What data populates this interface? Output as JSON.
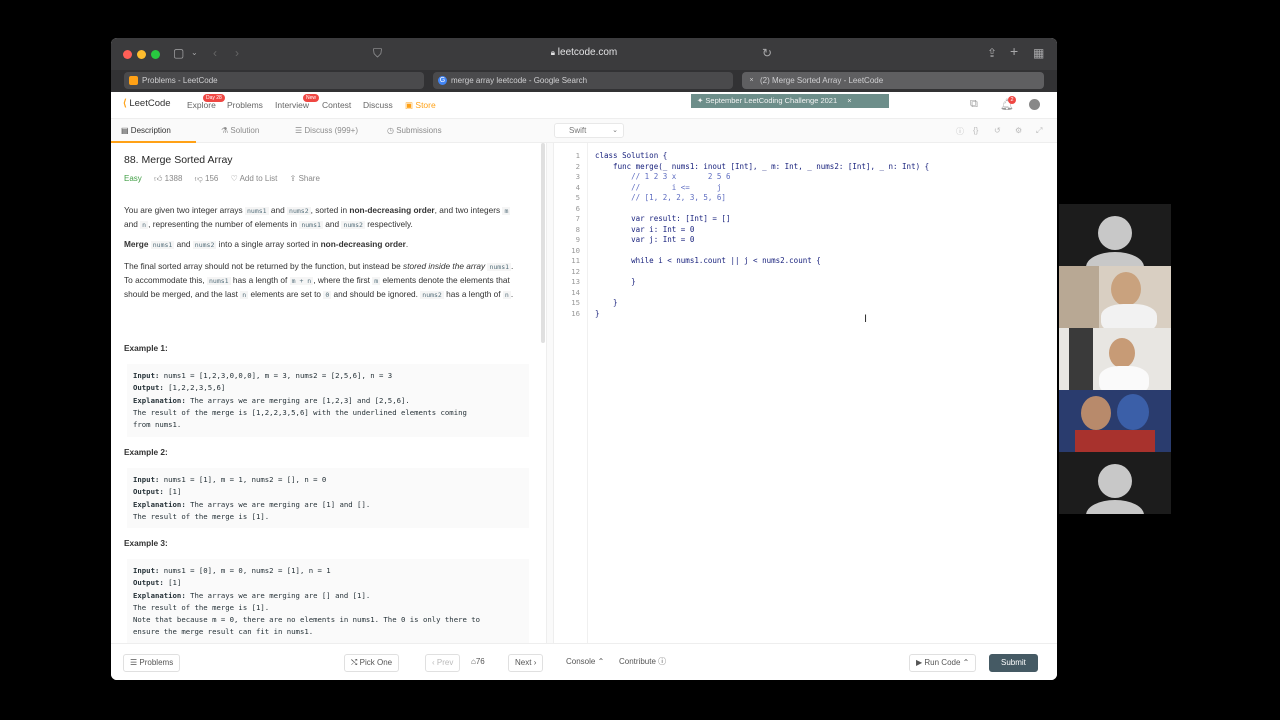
{
  "browser": {
    "url": "leetcode.com",
    "tabs": [
      {
        "title": "Problems - LeetCode"
      },
      {
        "title": "merge array leetcode - Google Search"
      },
      {
        "title": "(2) Merge Sorted Array - LeetCode"
      }
    ]
  },
  "nav": {
    "logo": "LeetCode",
    "items": [
      "Explore",
      "Problems",
      "Interview",
      "Contest",
      "Discuss",
      "Store"
    ],
    "explore_badge": "Day 28",
    "interview_badge": "New",
    "challenge": "September LeetCoding Challenge 2021",
    "notification_count": "2"
  },
  "subtabs": {
    "description": "Description",
    "solution": "Solution",
    "discuss": "Discuss (999+)",
    "submissions": "Submissions",
    "language": "Swift"
  },
  "problem": {
    "title": "88. Merge Sorted Array",
    "difficulty": "Easy",
    "likes": "1388",
    "dislikes": "156",
    "add_to_list": "Add to List",
    "share": "Share",
    "p1": {
      "a": "You are given two integer arrays ",
      "c1": "nums1",
      "b": " and ",
      "c2": "nums2",
      "c": ", sorted in ",
      "bold": "non-decreasing order",
      "d": ", and two integers ",
      "c3": "m",
      "e": " and ",
      "c4": "n",
      "f": ", representing the number of elements in ",
      "c5": "nums1",
      "g": " and ",
      "c6": "nums2",
      "h": " respectively."
    },
    "p2": {
      "bold1": "Merge",
      "c1": "nums1",
      "a": " and ",
      "c2": "nums2",
      "b": " into a single array sorted in ",
      "bold2": "non-decreasing order",
      "c": "."
    },
    "p3": {
      "a": "The final sorted array should not be returned by the function, but instead be ",
      "ital": "stored inside the array",
      "c1": "nums1",
      "b": ". To accommodate this, ",
      "c2": "nums1",
      "c": " has a length of ",
      "c3": "m + n",
      "d": ", where the first ",
      "c4": "m",
      "e": " elements denote the elements that should be merged, and the last ",
      "c5": "n",
      "f": " elements are set to ",
      "c6": "0",
      "g": " and should be ignored. ",
      "c7": "nums2",
      "h": " has a length of ",
      "c8": "n",
      "i": "."
    },
    "examples": [
      {
        "title": "Example 1:",
        "input": " nums1 = [1,2,3,0,0,0], m = 3, nums2 = [2,5,6], n = 3",
        "output": " [1,2,2,3,5,6]",
        "explanation": " The arrays we are merging are [1,2,3] and [2,5,6].",
        "extra1": "The result of the merge is [1,2,2,3,5,6] with the underlined elements coming",
        "extra2": "from nums1.",
        "extra3": ""
      },
      {
        "title": "Example 2:",
        "input": " nums1 = [1], m = 1, nums2 = [], n = 0",
        "output": " [1]",
        "explanation": " The arrays we are merging are [1] and [].",
        "extra1": "The result of the merge is [1].",
        "extra2": "",
        "extra3": ""
      },
      {
        "title": "Example 3:",
        "input": " nums1 = [0], m = 0, nums2 = [1], n = 1",
        "output": " [1]",
        "explanation": " The arrays we are merging are [] and [1].",
        "extra1": "The result of the merge is [1].",
        "extra2": "Note that because m = 0, there are no elements in nums1. The 0 is only there to",
        "extra3": "ensure the merge result can fit in nums1."
      }
    ],
    "labels": {
      "input": "Input:",
      "output": "Output:",
      "explanation": "Explanation:"
    }
  },
  "code": [
    {
      "n": "1",
      "text": "class Solution {"
    },
    {
      "n": "2",
      "text": "    func merge(_ nums1: inout [Int], _ m: Int, _ nums2: [Int], _ n: Int) {"
    },
    {
      "n": "3",
      "text": "        // 1 2 3 x       2 5 6"
    },
    {
      "n": "4",
      "text": "        //       i <=      j"
    },
    {
      "n": "5",
      "text": "        // [1, 2, 2, 3, 5, 6]"
    },
    {
      "n": "6",
      "text": ""
    },
    {
      "n": "7",
      "text": "        var result: [Int] = []"
    },
    {
      "n": "8",
      "text": "        var i: Int = 0"
    },
    {
      "n": "9",
      "text": "        var j: Int = 0"
    },
    {
      "n": "10",
      "text": ""
    },
    {
      "n": "11",
      "text": "        while i < nums1.count || j < nums2.count {"
    },
    {
      "n": "12",
      "text": ""
    },
    {
      "n": "13",
      "text": "        }"
    },
    {
      "n": "14",
      "text": ""
    },
    {
      "n": "15",
      "text": "    }"
    },
    {
      "n": "16",
      "text": "}"
    }
  ],
  "bottom": {
    "problems": "Problems",
    "pick_one": "Pick One",
    "prev": "Prev",
    "page": "76",
    "next": "Next",
    "console": "Console",
    "contribute": "Contribute",
    "run_code": "Run Code",
    "submit": "Submit"
  },
  "colors": {
    "accent": "#ffa116",
    "easy": "#43a047",
    "submit": "#455a64"
  }
}
